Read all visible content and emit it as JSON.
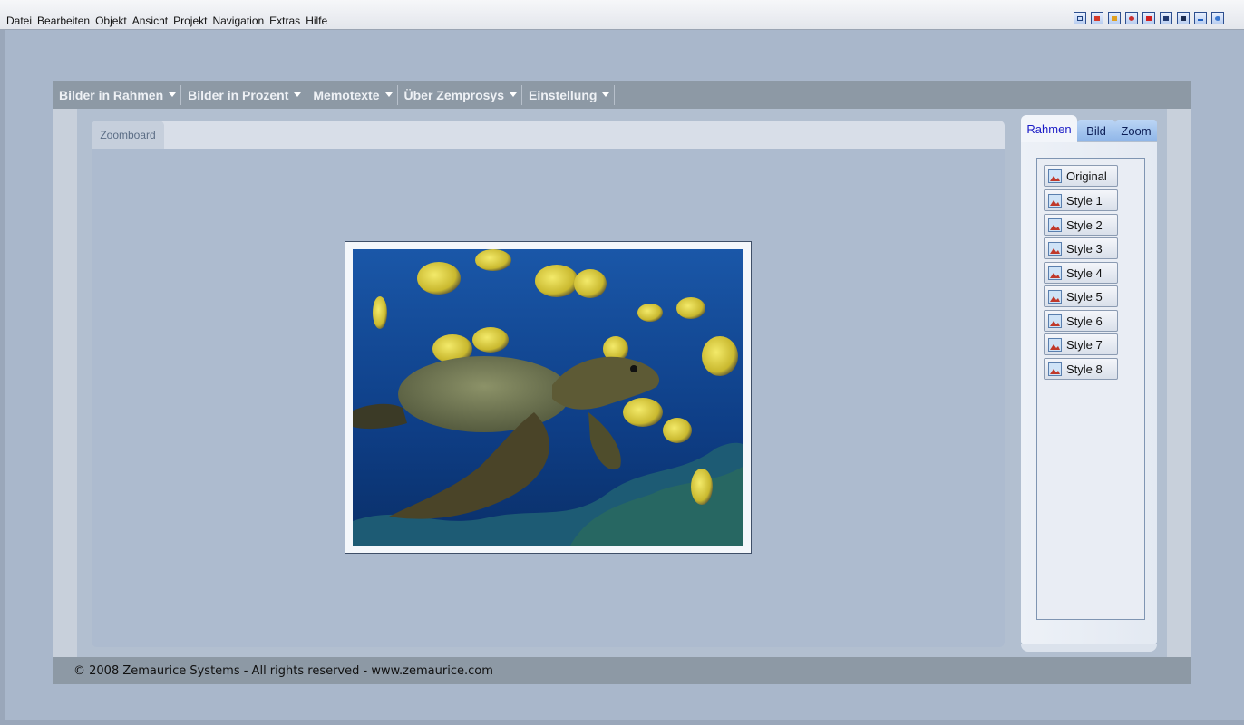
{
  "menubar": {
    "items": [
      "Datei",
      "Bearbeiten",
      "Objekt",
      "Ansicht",
      "Projekt",
      "Navigation",
      "Extras",
      "Hilfe"
    ],
    "toolbar_icons": [
      "window-icon",
      "chart-icon",
      "mail-icon",
      "gear-icon",
      "flag-icon",
      "users-icon",
      "film-icon",
      "check-icon",
      "help-icon"
    ]
  },
  "nav": {
    "items": [
      "Bilder in Rahmen",
      "Bilder in Prozent",
      "Memotexte",
      "Über Zemprosys",
      "Einstellung"
    ]
  },
  "zoomboard": {
    "tab_label": "Zoomboard",
    "image": "sea-turtle-with-yellow-fish"
  },
  "side_panel": {
    "tabs": [
      "Rahmen",
      "Bild",
      "Zoom"
    ],
    "active_tab": "Rahmen",
    "styles": [
      "Original",
      "Style 1",
      "Style 2",
      "Style 3",
      "Style 4",
      "Style 5",
      "Style 6",
      "Style 7",
      "Style 8"
    ]
  },
  "footer": {
    "text": "© 2008 Zemaurice Systems - All rights reserved - www.zemaurice.com"
  },
  "colors": {
    "background": "#a9b7cb",
    "nav_bar": "#8d99a5",
    "active_tab_text": "#1b1cc6"
  }
}
